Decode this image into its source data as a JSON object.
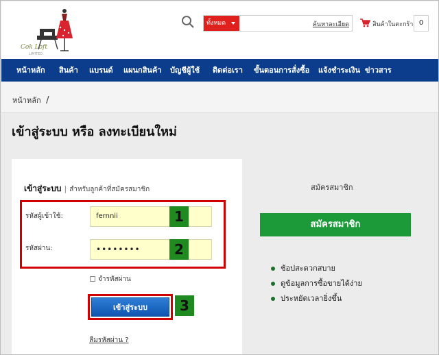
{
  "header": {
    "logo_text": "Cok Loft",
    "logo_sub": "LIMITED",
    "search": {
      "category_label": "ทั้งหมด",
      "placeholder": "",
      "advanced_label": "ค้นหาละเอียด"
    },
    "cart": {
      "label": "สินค้าในตะกร้า",
      "count": "0"
    }
  },
  "nav": {
    "items": [
      {
        "label": "หน้าหลัก"
      },
      {
        "label": "สินค้า"
      },
      {
        "label": "แบรนด์"
      },
      {
        "label": "แผนกสินค้า"
      },
      {
        "label": "บัญชีผู้ใช้"
      },
      {
        "label": "ติดต่อเรา"
      },
      {
        "label": "ขั้นตอนการสั่งซื้อ"
      },
      {
        "label": "แจ้งชำระเงิน"
      },
      {
        "label": "ข่าวสาร"
      }
    ]
  },
  "breadcrumb": {
    "home": "หน้าหลัก",
    "separator": "/"
  },
  "page": {
    "title": "เข้าสู่ระบบ หรือ ลงทะเบียนใหม่"
  },
  "login": {
    "heading": "เข้าสู่ระบบ",
    "divider": "|",
    "subheading": "สำหรับลูกค้าที่สมัครสมาชิก",
    "username_label": "รหัสผู้เข้าใช้:",
    "username_value": "fernnii",
    "password_label": "รหัสผ่าน:",
    "password_value": "••••••••",
    "remember_label": "จำรหัสผ่าน",
    "button_label": "เข้าสู่ระบบ",
    "forgot_label": "ลืมรหัสผ่าน ?",
    "annotations": [
      "1",
      "2",
      "3"
    ]
  },
  "register": {
    "title": "สมัครสมาชิก",
    "button_label": "สมัครสมาชิก",
    "benefits": [
      "ช้อปสะดวกสบาย",
      "ดูข้อมูลการซื้อขายได้ง่าย",
      "ประหยัดเวลายิ่งขึ้น"
    ]
  },
  "colors": {
    "nav_bg": "#0b3d8c",
    "search_select": "#e0201c",
    "annotation_red": "#d10000",
    "annotation_green": "#1f8a1f",
    "register_green": "#1c9a3a",
    "login_blue": "#1a63c0",
    "input_yellow": "#ffffcc"
  },
  "icons": {
    "search": "search-icon",
    "cart": "cart-icon",
    "logo": "dress-sewing-logo-icon"
  }
}
